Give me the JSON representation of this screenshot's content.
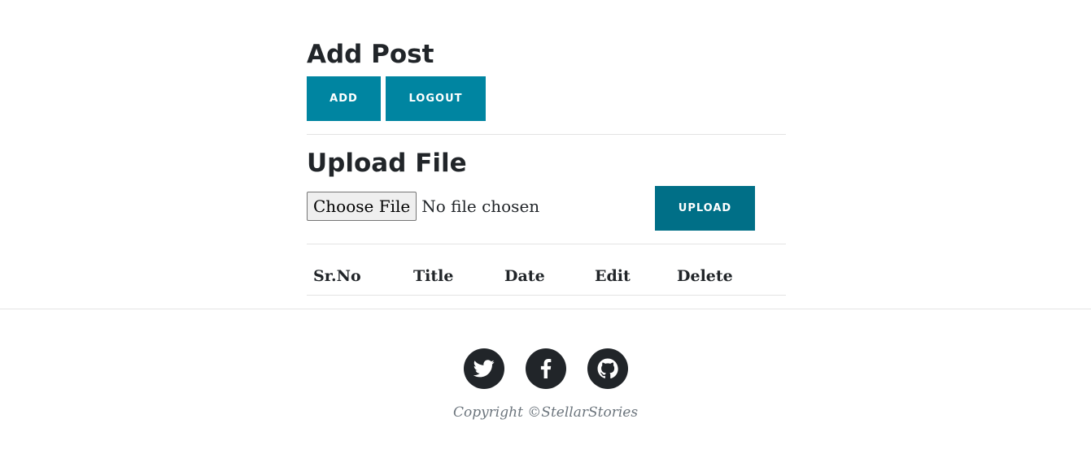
{
  "add_post": {
    "heading": "Add Post",
    "add_label": "ADD",
    "logout_label": "LOGOUT"
  },
  "upload": {
    "heading": "Upload File",
    "choose_label": "Choose File",
    "status": "No file chosen",
    "upload_label": "UPLOAD"
  },
  "table": {
    "headers": [
      "Sr.No",
      "Title",
      "Date",
      "Edit",
      "Delete"
    ],
    "rows": []
  },
  "footer": {
    "social": [
      "twitter-icon",
      "facebook-icon",
      "github-icon"
    ],
    "copyright": "Copyright ©StellarStories"
  },
  "colors": {
    "primary_button": "#0085a1",
    "upload_button": "#006f87",
    "heading_text": "#212529",
    "muted_text": "#6c757d",
    "social_bg": "#212529"
  }
}
